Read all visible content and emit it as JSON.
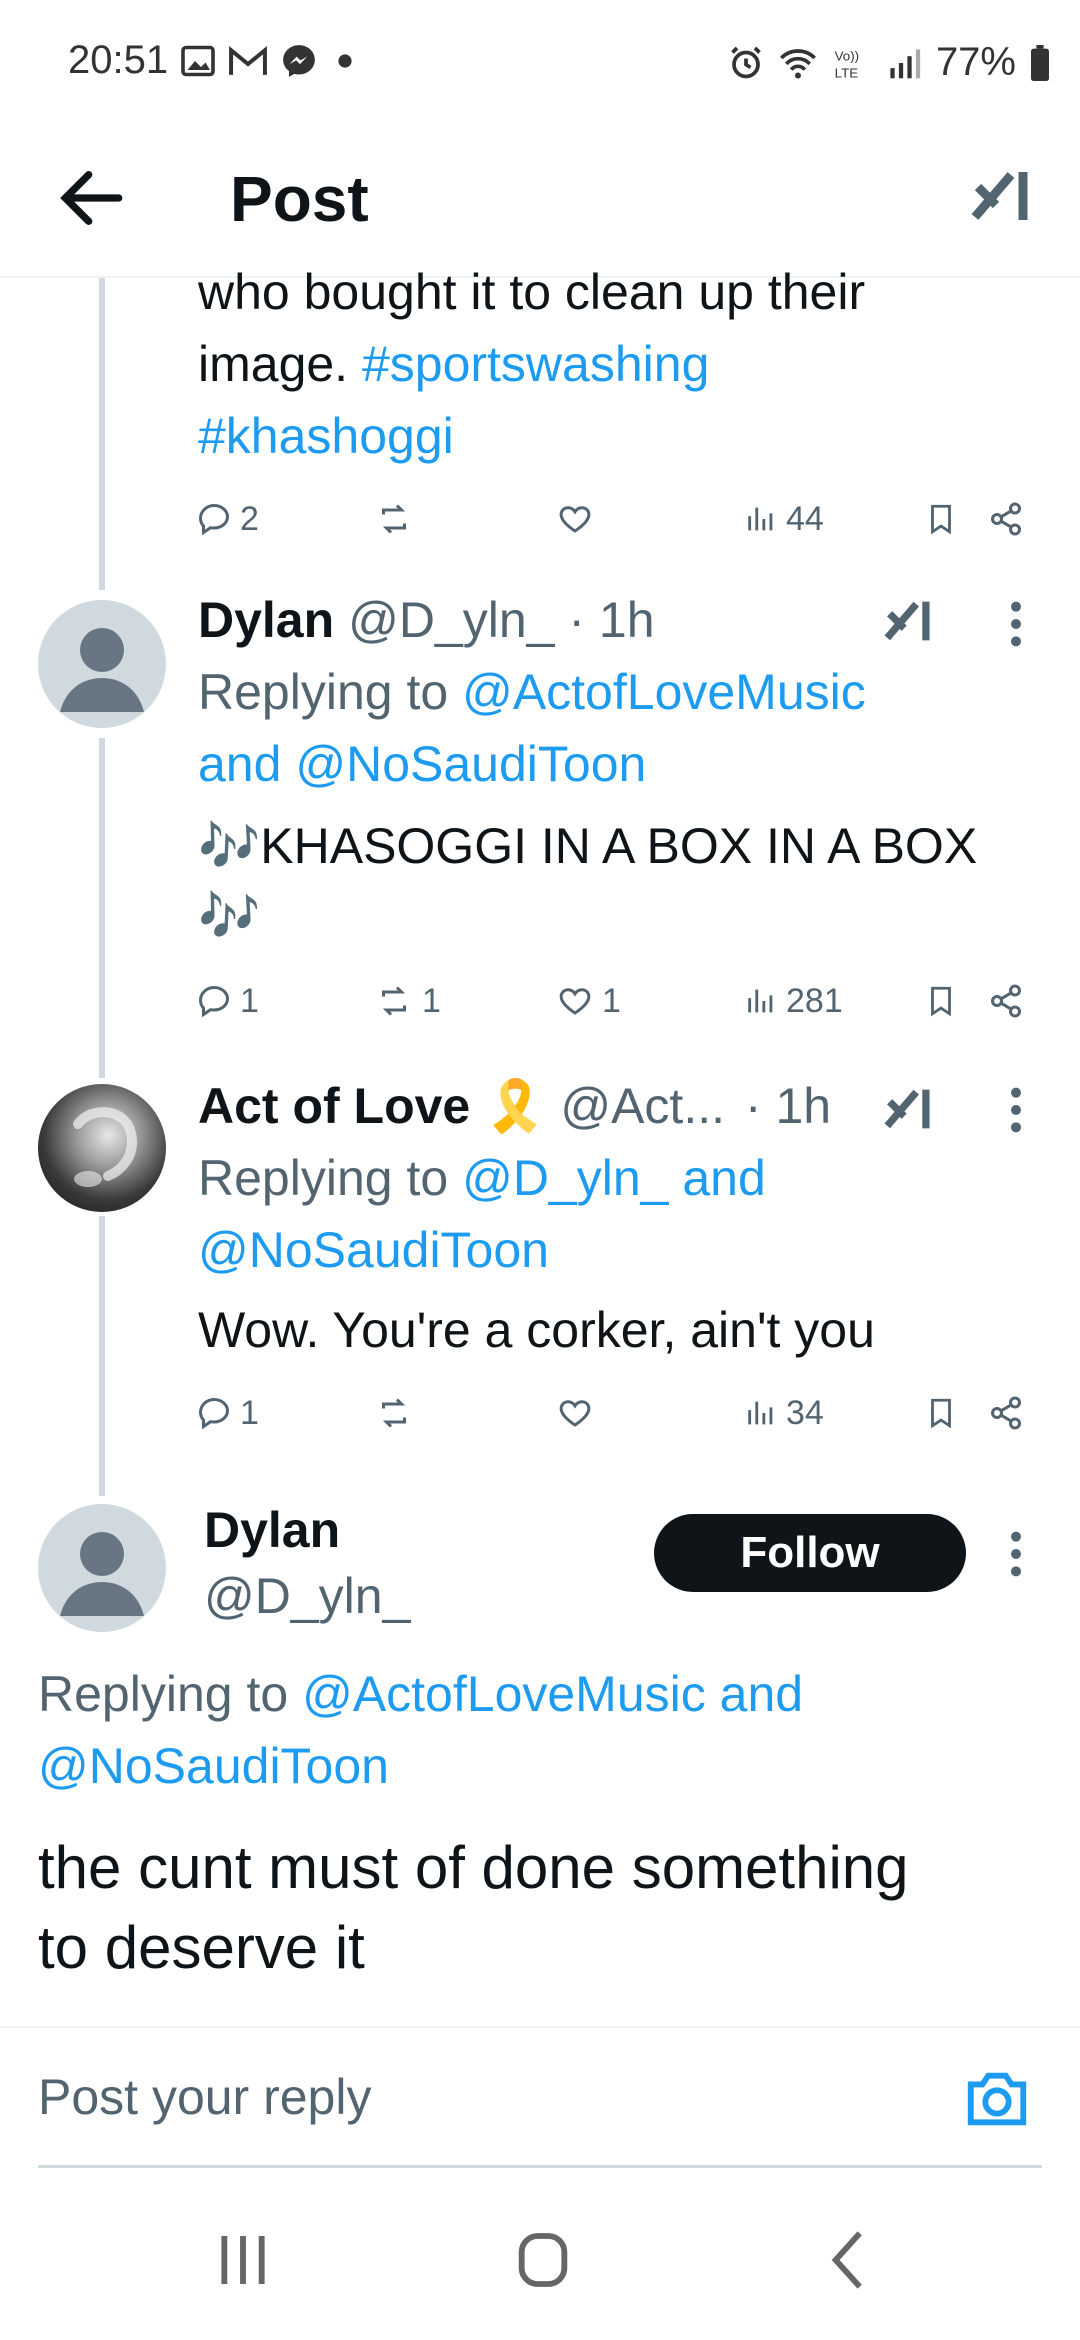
{
  "status_bar": {
    "time": "20:51",
    "battery": "77%",
    "left_icons": [
      "gallery-icon",
      "gmail-icon",
      "messenger-icon",
      "dot-icon"
    ],
    "right_icons": [
      "alarm-icon",
      "wifi-icon",
      "volte-icon",
      "signal-icon",
      "battery-icon"
    ]
  },
  "header": {
    "title": "Post",
    "back_icon": "arrow-left-icon",
    "grok_icon": "grok-icon"
  },
  "colors": {
    "link": "#1d9bf0",
    "text": "#0f1419",
    "muted": "#536471",
    "follow_bg": "#0f1419"
  },
  "post0": {
    "text_lines": [
      "who bought it to clean up their"
    ],
    "line2_prefix": "image. ",
    "hashtag1": "#sportswashing",
    "hashtag2": "#khashoggi",
    "replies": "2",
    "reposts": "",
    "likes": "",
    "views": "44"
  },
  "reply1": {
    "name": "Dylan",
    "handle": "@D_yln_",
    "time": "· 1h",
    "replying_prefix": "Replying to",
    "mention1": "@ActofLoveMusic",
    "and_text": "and",
    "mention2": "@NoSaudiToon",
    "body_line1": "🎶KHASOGGI IN A BOX IN A BOX",
    "body_line2": "🎶",
    "replies": "1",
    "reposts": "1",
    "likes": "1",
    "views": "281"
  },
  "reply2": {
    "name": "Act of Love",
    "badge": "🎗️",
    "handle": "@Act...",
    "time": "· 1h",
    "replying_prefix": "Replying to",
    "mention1": "@D_yln_ and",
    "mention2": "@NoSaudiToon",
    "body": "Wow. You're a corker, ain't you",
    "replies": "1",
    "reposts": "",
    "likes": "",
    "views": "34"
  },
  "main_post": {
    "name": "Dylan",
    "handle": "@D_yln_",
    "follow_label": "Follow",
    "replying_prefix": "Replying to",
    "mention1": "@ActofLoveMusic and",
    "mention2": "@NoSaudiToon",
    "body_line1": "the cunt must of done something",
    "body_line2": "to deserve it"
  },
  "reply_box": {
    "placeholder": "Post your reply"
  }
}
